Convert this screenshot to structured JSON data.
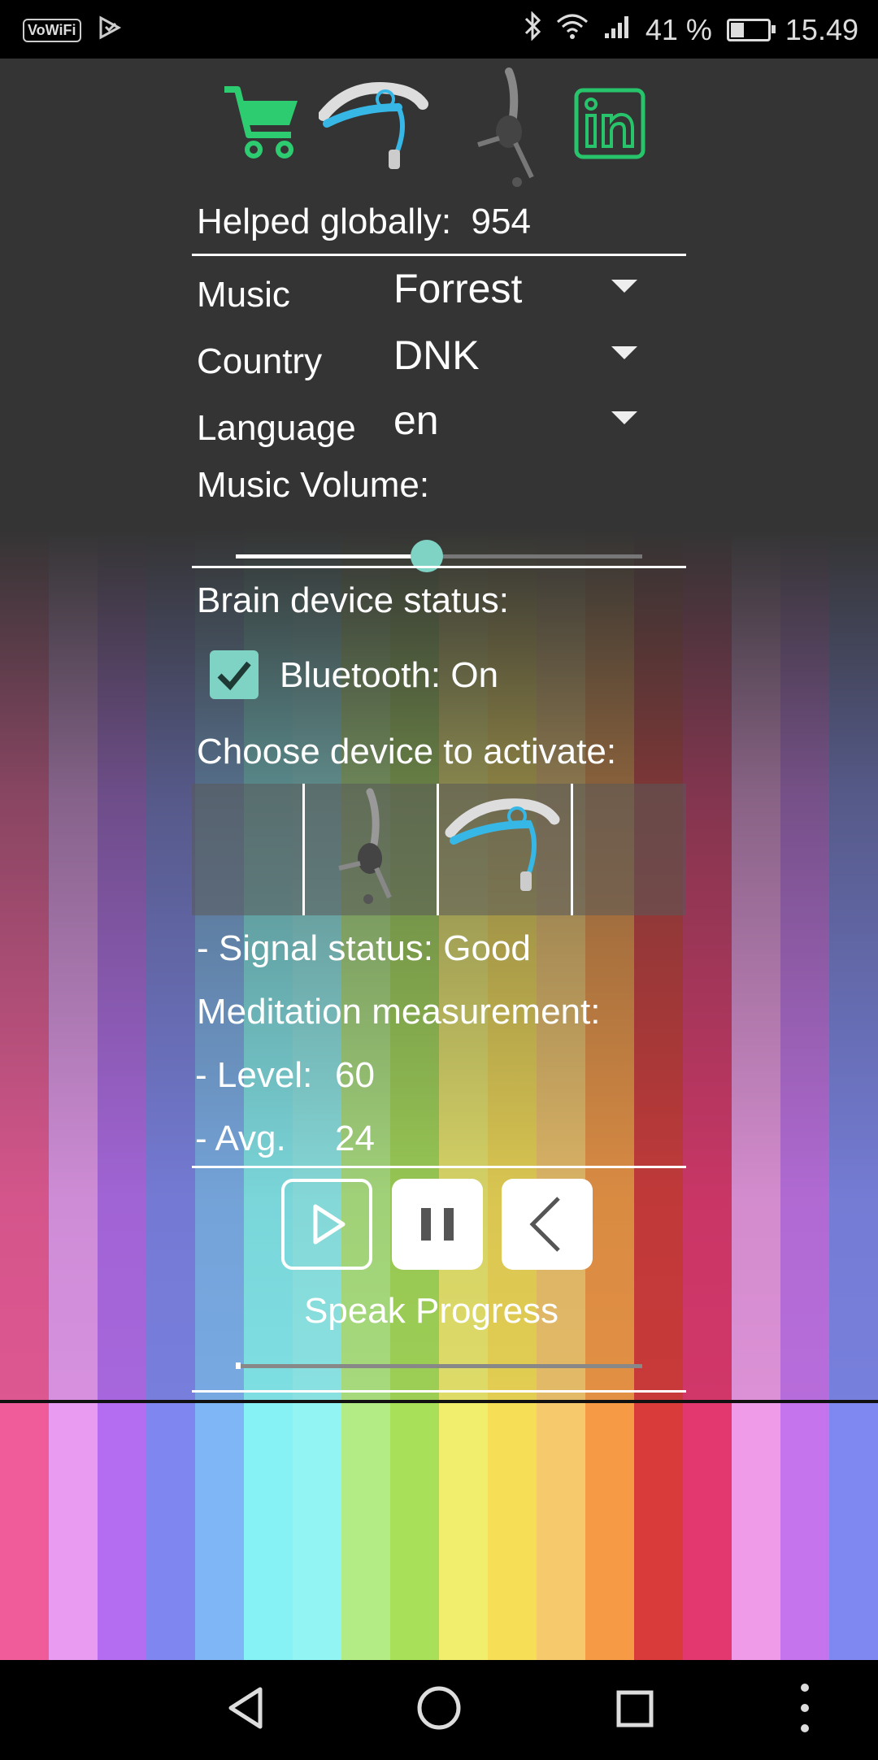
{
  "status_bar": {
    "vowifi": "VoWiFi",
    "battery_percent": "41 %",
    "battery_level": 0.41,
    "time": "15.49"
  },
  "top_icons": [
    "cart-icon",
    "headband-device-icon",
    "headset-device-icon",
    "linkedin-icon"
  ],
  "colors": {
    "accent": "#7fd3c4",
    "cart_green": "#2ecc71",
    "linkedin_green": "#27c46b",
    "stripes": [
      "#f05b9a",
      "#e99bf2",
      "#b46cf0",
      "#7f86ef",
      "#7fb6f5",
      "#86f2f6",
      "#93f4f4",
      "#b3ec84",
      "#a8e059",
      "#f1ee6e",
      "#f6df56",
      "#f7c96d",
      "#f69a45",
      "#d93a3a",
      "#e3376f",
      "#ef9be8",
      "#c673ee",
      "#7f88f0"
    ]
  },
  "helped": {
    "label": "Helped globally:",
    "value": "954"
  },
  "settings": {
    "music_label": "Music",
    "music_value": "Forrest",
    "country_label": "Country",
    "country_value": "DNK",
    "language_label": "Language",
    "language_value": "en",
    "volume_label": "Music Volume:",
    "volume_level": 0.47
  },
  "device_status": {
    "title": "Brain device status:",
    "bluetooth_label": "Bluetooth: On",
    "bluetooth_checked": true,
    "choose_label": "Choose device to activate:",
    "signal_status": "-  Signal status: Good"
  },
  "meditation": {
    "title": "Meditation measurement:",
    "level_label": "- Level:",
    "level_value": "60",
    "avg_label": "- Avg.",
    "avg_value": "24"
  },
  "speak": {
    "label": "Speak Progress",
    "progress": 0.01
  }
}
